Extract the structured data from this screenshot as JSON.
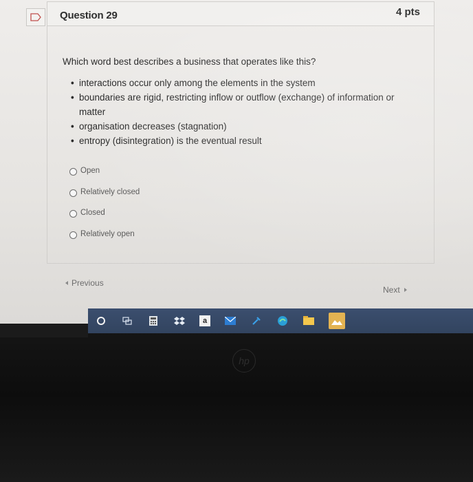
{
  "question": {
    "title": "Question 29",
    "points": "4 pts",
    "prompt": "Which word best describes a business that operates like this?",
    "bullets": [
      "interactions occur only among the elements in the system",
      "boundaries are rigid, restricting inflow or outflow (exchange) of information or matter",
      "organisation decreases (stagnation)",
      "entropy (disintegration) is the eventual result"
    ],
    "answers": [
      "Open",
      "Relatively closed",
      "Closed",
      "Relatively open"
    ]
  },
  "navigation": {
    "previous": "Previous",
    "next": "Next"
  },
  "taskbar": {
    "icons": [
      "search-icon",
      "task-view-icon",
      "calculator-icon",
      "dropbox-icon",
      "amazon-icon",
      "mail-icon",
      "tool-icon",
      "edge-icon",
      "file-explorer-icon",
      "photos-icon"
    ],
    "amazon_label": "a"
  },
  "colors": {
    "taskbar": "#3b4e6e",
    "text": "#2b2b2b",
    "muted": "#6d6d6d"
  }
}
